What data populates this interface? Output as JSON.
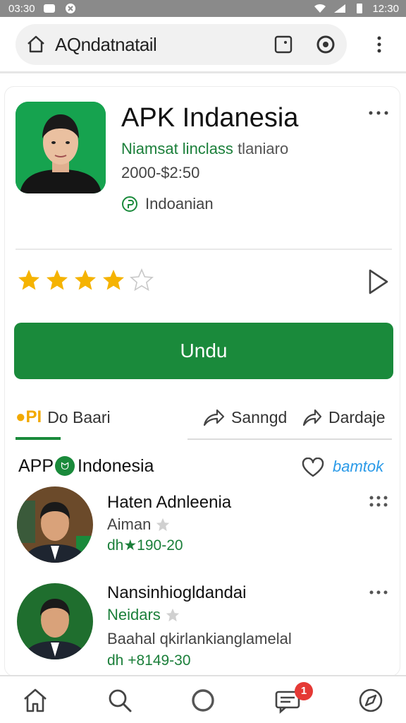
{
  "status_bar": {
    "time_left": "03:30",
    "time_right": "12:30"
  },
  "browser": {
    "url": "AQndatnatail"
  },
  "app": {
    "title": "APK Indanesia",
    "developer_green": "Niamsat linclass",
    "developer_rest": "tlaniaro",
    "price": "2000-$2:50",
    "region": "Indoanian",
    "rating_stars": 4,
    "rating_max": 5,
    "install_label": "Undu"
  },
  "actions": {
    "first_logo": "PI",
    "first_label": "Do Baari",
    "share_label": "Sanngd",
    "download_label": "Dardaje"
  },
  "section": {
    "title_prefix": "APP",
    "title_suffix": "Indonesia",
    "badge_glyph": "ᗢ",
    "link": "bamtok"
  },
  "reviews": [
    {
      "name": "Haten Adnleenia",
      "sub": "Aiman",
      "meta": "dh★190-20"
    },
    {
      "name": "Nansinhiogldandai",
      "sub": "Neidars",
      "extra": "Baahal qkirlankianglamelal",
      "meta": "dh +8149-30"
    }
  ],
  "nav": {
    "notification_count": "1"
  },
  "colors": {
    "brand_green": "#1a8a3b",
    "star_gold": "#f5b301",
    "link_blue": "#2a9ae8",
    "badge_red": "#e53935"
  },
  "icons": [
    "home-icon",
    "tab-icon",
    "refresh-icon",
    "more-vert-icon",
    "more-horiz-icon",
    "region-icon",
    "star-icon",
    "play-icon",
    "share-icon",
    "heart-icon",
    "search-icon",
    "circle-icon",
    "chat-icon",
    "compass-icon"
  ]
}
